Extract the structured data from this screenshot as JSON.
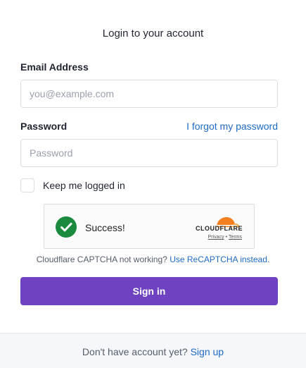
{
  "page": {
    "title": "Login to your account"
  },
  "form": {
    "email_label": "Email Address",
    "email_placeholder": "you@example.com",
    "password_label": "Password",
    "forgot_link": "I forgot my password",
    "password_placeholder": "Password",
    "remember_label": "Keep me logged in",
    "submit_label": "Sign in"
  },
  "captcha": {
    "status_text": "Success!",
    "brand": "CLOUDFLARE",
    "privacy_link": "Privacy",
    "separator": "•",
    "terms_link": "Terms",
    "note_text": "Cloudflare CAPTCHA not working?",
    "note_link": "Use ReCAPTCHA instead."
  },
  "footer": {
    "text": "Don't have account yet?",
    "signup_link": "Sign up"
  },
  "colors": {
    "accent": "#6f42c1",
    "link": "#206bc4",
    "success": "#1a8a3e",
    "cloudflare_orange": "#f38020"
  },
  "icons": {
    "captcha_status": "check-circle-icon",
    "captcha_brand": "cloudflare-logo-icon"
  }
}
